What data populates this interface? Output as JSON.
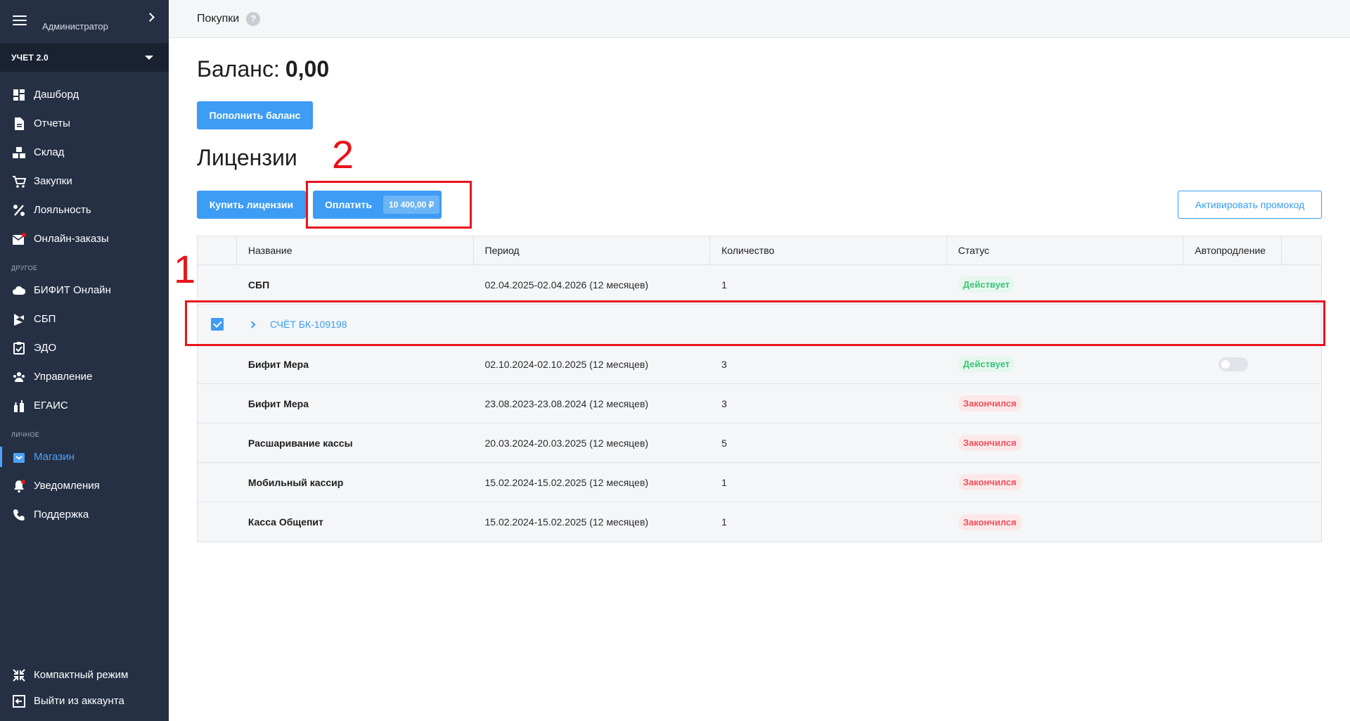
{
  "sidebar": {
    "user": "Администратор",
    "org": "УЧЕТ 2.0",
    "nav": [
      {
        "label": "Дашборд",
        "icon": "dashboard-icon"
      },
      {
        "label": "Отчеты",
        "icon": "document-icon"
      },
      {
        "label": "Склад",
        "icon": "boxes-icon"
      },
      {
        "label": "Закупки",
        "icon": "cart-icon"
      },
      {
        "label": "Лояльность",
        "icon": "percent-icon"
      },
      {
        "label": "Онлайн-заказы",
        "icon": "mail-icon"
      }
    ],
    "section_other": "ДРУГОЕ",
    "other": [
      {
        "label": "БИФИТ Онлайн",
        "icon": "cloud-icon"
      },
      {
        "label": "СБП",
        "icon": "sbp-icon"
      },
      {
        "label": "ЭДО",
        "icon": "edo-icon"
      },
      {
        "label": "Управление",
        "icon": "users-icon"
      },
      {
        "label": "ЕГАИС",
        "icon": "bottles-icon"
      }
    ],
    "section_personal": "ЛИЧНОЕ",
    "personal": [
      {
        "label": "Магазин",
        "icon": "store-icon",
        "active": true
      },
      {
        "label": "Уведомления",
        "icon": "bell-icon"
      },
      {
        "label": "Поддержка",
        "icon": "phone-icon"
      }
    ],
    "bottom": [
      {
        "label": "Компактный режим",
        "icon": "compress-icon"
      },
      {
        "label": "Выйти из аккаунта",
        "icon": "logout-icon"
      }
    ]
  },
  "topbar": {
    "title": "Покупки",
    "help": "?"
  },
  "balance": {
    "label": "Баланс:",
    "value": "0,00"
  },
  "buttons": {
    "topup": "Пополнить баланс",
    "buy": "Купить лицензии",
    "pay": "Оплатить",
    "pay_amount": "10 400,00 ₽",
    "promo": "Активировать промокод"
  },
  "licenses_title": "Лицензии",
  "annotations": {
    "one": "1",
    "two": "2"
  },
  "table": {
    "columns": [
      "Название",
      "Период",
      "Количество",
      "Статус",
      "Автопродление"
    ],
    "rows": [
      {
        "name": "СБП",
        "period": "02.04.2025-02.04.2026 (12 месяцев)",
        "qty": "1",
        "status": "Действует",
        "status_type": "ok"
      },
      {
        "name": "Бифит Мера",
        "period": "02.10.2024-02.10.2025 (12 месяцев)",
        "qty": "3",
        "status": "Действует",
        "status_type": "ok",
        "autorenew_toggle": "off"
      },
      {
        "name": "Бифит Мера",
        "period": "23.08.2023-23.08.2024 (12 месяцев)",
        "qty": "3",
        "status": "Закончился",
        "status_type": "expired"
      },
      {
        "name": "Расшаривание кассы",
        "period": "20.03.2024-20.03.2025 (12 месяцев)",
        "qty": "5",
        "status": "Закончился",
        "status_type": "expired"
      },
      {
        "name": "Мобильный кассир",
        "period": "15.02.2024-15.02.2025 (12 месяцев)",
        "qty": "1",
        "status": "Закончился",
        "status_type": "expired"
      },
      {
        "name": "Касса Общепит",
        "period": "15.02.2024-15.02.2025 (12 месяцев)",
        "qty": "1",
        "status": "Закончился",
        "status_type": "expired"
      }
    ],
    "invoice": {
      "label": "СЧЁТ БК-109198",
      "checked": true
    }
  },
  "colors": {
    "accent": "#3d9cf3",
    "sidebar": "#253044",
    "ok": "#3cc47c",
    "expired": "#f0515a",
    "annotation": "#e8141c"
  }
}
